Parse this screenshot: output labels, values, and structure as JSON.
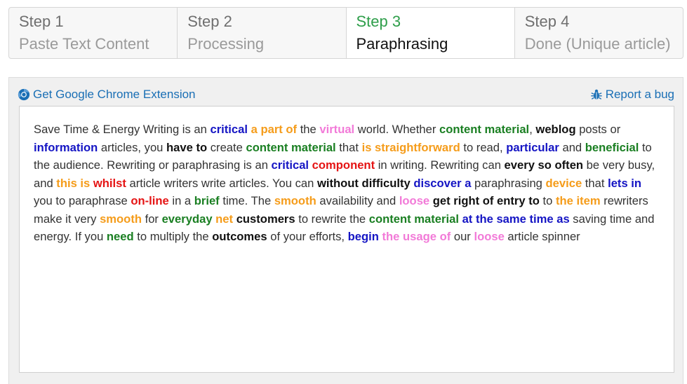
{
  "steps": [
    {
      "num": "Step 1",
      "name": "Paste Text Content",
      "active": false
    },
    {
      "num": "Step 2",
      "name": "Processing",
      "active": false
    },
    {
      "num": "Step 3",
      "name": "Paraphrasing",
      "active": true
    },
    {
      "num": "Step 4",
      "name": "Done (Unique article)",
      "active": false
    }
  ],
  "toolbar": {
    "chrome_extension_label": "Get Google Chrome Extension",
    "report_bug_label": "Report a bug",
    "chrome_icon": "chrome-icon",
    "bug_icon": "bug-icon"
  },
  "colors": {
    "link": "#1a6fb5",
    "active_step": "#2e9e4a",
    "blue": "#1515c4",
    "green": "#1a7f22",
    "orange": "#f59c1a",
    "pink": "#f27ad8",
    "red": "#e51414",
    "black": "#111111"
  },
  "output": {
    "segments": [
      {
        "t": "Save Time & Energy Writing is an "
      },
      {
        "t": "critical",
        "c": "blue"
      },
      {
        "t": " "
      },
      {
        "t": "a part of",
        "c": "orange"
      },
      {
        "t": " the "
      },
      {
        "t": "virtual",
        "c": "pink"
      },
      {
        "t": " world. Whether "
      },
      {
        "t": "content material",
        "c": "green"
      },
      {
        "t": ", "
      },
      {
        "t": "weblog",
        "c": "black"
      },
      {
        "t": " posts or "
      },
      {
        "t": "information",
        "c": "blue"
      },
      {
        "t": " articles, you "
      },
      {
        "t": "have to",
        "c": "black"
      },
      {
        "t": " create "
      },
      {
        "t": "content material",
        "c": "green"
      },
      {
        "t": " that "
      },
      {
        "t": "is straightforward",
        "c": "orange"
      },
      {
        "t": " to read, "
      },
      {
        "t": "particular",
        "c": "blue"
      },
      {
        "t": " and "
      },
      {
        "t": "beneficial",
        "c": "green"
      },
      {
        "t": " to the audience. Rewriting or paraphrasing is an "
      },
      {
        "t": "critical",
        "c": "blue"
      },
      {
        "t": " "
      },
      {
        "t": "component",
        "c": "red"
      },
      {
        "t": " in writing. Rewriting can "
      },
      {
        "t": "every so often",
        "c": "black"
      },
      {
        "t": " be very busy, and "
      },
      {
        "t": "this is",
        "c": "orange"
      },
      {
        "t": " "
      },
      {
        "t": "whilst",
        "c": "red"
      },
      {
        "t": " article writers write articles. You can "
      },
      {
        "t": "without difficulty",
        "c": "black"
      },
      {
        "t": " "
      },
      {
        "t": "discover a",
        "c": "blue"
      },
      {
        "t": " paraphrasing "
      },
      {
        "t": "device",
        "c": "orange"
      },
      {
        "t": " that "
      },
      {
        "t": "lets in",
        "c": "blue"
      },
      {
        "t": " you to paraphrase "
      },
      {
        "t": "on-line",
        "c": "red"
      },
      {
        "t": " in a "
      },
      {
        "t": "brief",
        "c": "green"
      },
      {
        "t": " time. The "
      },
      {
        "t": "smooth",
        "c": "orange"
      },
      {
        "t": " availability and "
      },
      {
        "t": "loose",
        "c": "pink"
      },
      {
        "t": " "
      },
      {
        "t": "get right of entry to",
        "c": "black"
      },
      {
        "t": " to "
      },
      {
        "t": "the item",
        "c": "orange"
      },
      {
        "t": " rewriters make it very "
      },
      {
        "t": "smooth",
        "c": "orange"
      },
      {
        "t": " for "
      },
      {
        "t": "everyday",
        "c": "green"
      },
      {
        "t": " "
      },
      {
        "t": "net",
        "c": "orange"
      },
      {
        "t": " "
      },
      {
        "t": "customers",
        "c": "black"
      },
      {
        "t": " to rewrite the "
      },
      {
        "t": "content material",
        "c": "green"
      },
      {
        "t": " "
      },
      {
        "t": "at the same time as",
        "c": "blue"
      },
      {
        "t": " saving time and energy. If you "
      },
      {
        "t": "need",
        "c": "green"
      },
      {
        "t": " to multiply the "
      },
      {
        "t": "outcomes",
        "c": "black"
      },
      {
        "t": " of your efforts, "
      },
      {
        "t": "begin",
        "c": "blue"
      },
      {
        "t": " "
      },
      {
        "t": "the usage of",
        "c": "pink"
      },
      {
        "t": " our "
      },
      {
        "t": "loose",
        "c": "pink"
      },
      {
        "t": " article spinner"
      }
    ]
  }
}
